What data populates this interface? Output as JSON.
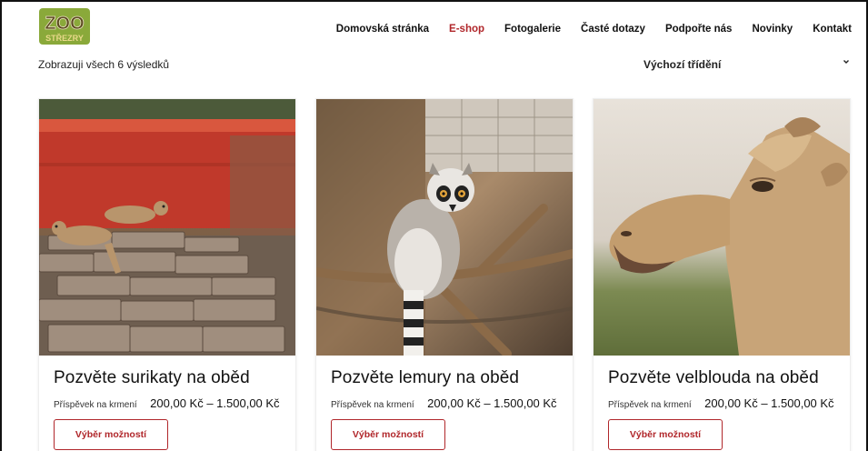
{
  "header": {
    "logo_text_top": "ZOO",
    "logo_text_bottom": "STŘEZRY",
    "nav": [
      {
        "label": "Domovská stránka",
        "active": false
      },
      {
        "label": "E-shop",
        "active": true
      },
      {
        "label": "Fotogalerie",
        "active": false
      },
      {
        "label": "Časté dotazy",
        "active": false
      },
      {
        "label": "Podpořte nás",
        "active": false
      },
      {
        "label": "Novinky",
        "active": false
      },
      {
        "label": "Kontakt",
        "active": false
      }
    ]
  },
  "toolbar": {
    "results_count": "Zobrazuji všech 6 výsledků",
    "sort_selected": "Výchozí třídění",
    "sort_icon": "chevron-down-icon"
  },
  "products": [
    {
      "title": "Pozvěte surikaty na oběd",
      "price_label": "Příspěvek na krmení",
      "price": "200,00 Kč – 1.500,00 Kč",
      "button": "Výběr možností",
      "image": "meerkats-photo"
    },
    {
      "title": "Pozvěte lemury na oběd",
      "price_label": "Příspěvek na krmení",
      "price": "200,00 Kč – 1.500,00 Kč",
      "button": "Výběr možností",
      "image": "lemur-photo"
    },
    {
      "title": "Pozvěte velblouda na oběd",
      "price_label": "Příspěvek na krmení",
      "price": "200,00 Kč – 1.500,00 Kč",
      "button": "Výběr možností",
      "image": "camel-photo"
    }
  ],
  "colors": {
    "accent": "#b0262a",
    "text": "#111111"
  }
}
